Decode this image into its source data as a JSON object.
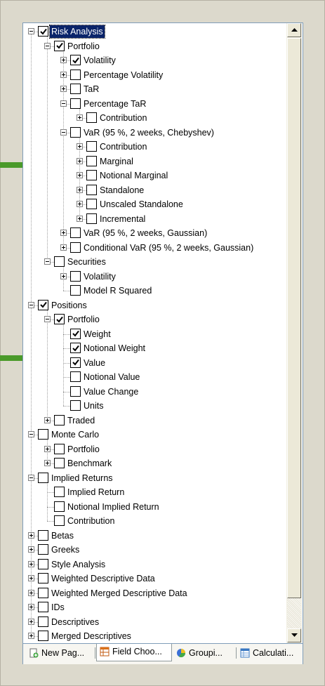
{
  "tree": [
    {
      "label": "Risk Analysis",
      "checked": true,
      "expander": "minus",
      "selected": true
    },
    {
      "label": "Portfolio",
      "checked": true,
      "expander": "minus"
    },
    {
      "label": "Volatility",
      "checked": true,
      "expander": "plus"
    },
    {
      "label": "Percentage Volatility",
      "checked": false,
      "expander": "plus"
    },
    {
      "label": "TaR",
      "checked": false,
      "expander": "plus"
    },
    {
      "label": "Percentage TaR",
      "checked": false,
      "expander": "minus"
    },
    {
      "label": "Contribution",
      "checked": false,
      "expander": "plus"
    },
    {
      "label": "VaR (95 %, 2 weeks, Chebyshev)",
      "checked": false,
      "expander": "minus"
    },
    {
      "label": "Contribution",
      "checked": false,
      "expander": "plus"
    },
    {
      "label": "Marginal",
      "checked": false,
      "expander": "plus"
    },
    {
      "label": "Notional Marginal",
      "checked": false,
      "expander": "plus"
    },
    {
      "label": "Standalone",
      "checked": false,
      "expander": "plus"
    },
    {
      "label": "Unscaled Standalone",
      "checked": false,
      "expander": "plus"
    },
    {
      "label": "Incremental",
      "checked": false,
      "expander": "plus"
    },
    {
      "label": "VaR (95 %, 2 weeks, Gaussian)",
      "checked": false,
      "expander": "plus"
    },
    {
      "label": "Conditional VaR (95 %, 2 weeks, Gaussian)",
      "checked": false,
      "expander": "plus"
    },
    {
      "label": "Securities",
      "checked": false,
      "expander": "minus"
    },
    {
      "label": "Volatility",
      "checked": false,
      "expander": "plus"
    },
    {
      "label": "Model R Squared",
      "checked": false,
      "expander": "none"
    },
    {
      "label": "Positions",
      "checked": true,
      "expander": "minus"
    },
    {
      "label": "Portfolio",
      "checked": true,
      "expander": "minus"
    },
    {
      "label": "Weight",
      "checked": true,
      "expander": "none"
    },
    {
      "label": "Notional Weight",
      "checked": true,
      "expander": "none"
    },
    {
      "label": "Value",
      "checked": true,
      "expander": "none"
    },
    {
      "label": "Notional Value",
      "checked": false,
      "expander": "none"
    },
    {
      "label": "Value Change",
      "checked": false,
      "expander": "none"
    },
    {
      "label": "Units",
      "checked": false,
      "expander": "none"
    },
    {
      "label": "Traded",
      "checked": false,
      "expander": "plus"
    },
    {
      "label": "Monte Carlo",
      "checked": false,
      "expander": "minus"
    },
    {
      "label": "Portfolio",
      "checked": false,
      "expander": "plus"
    },
    {
      "label": "Benchmark",
      "checked": false,
      "expander": "plus"
    },
    {
      "label": "Implied Returns",
      "checked": false,
      "expander": "minus"
    },
    {
      "label": "Implied Return",
      "checked": false,
      "expander": "none"
    },
    {
      "label": "Notional Implied Return",
      "checked": false,
      "expander": "none"
    },
    {
      "label": "Contribution",
      "checked": false,
      "expander": "none"
    },
    {
      "label": "Betas",
      "checked": false,
      "expander": "plus"
    },
    {
      "label": "Greeks",
      "checked": false,
      "expander": "plus"
    },
    {
      "label": "Style Analysis",
      "checked": false,
      "expander": "plus"
    },
    {
      "label": "Weighted Descriptive Data",
      "checked": false,
      "expander": "plus"
    },
    {
      "label": "Weighted Merged Descriptive Data",
      "checked": false,
      "expander": "plus"
    },
    {
      "label": "IDs",
      "checked": false,
      "expander": "plus"
    },
    {
      "label": "Descriptives",
      "checked": false,
      "expander": "plus"
    },
    {
      "label": "Merged Descriptives",
      "checked": false,
      "expander": "plus"
    }
  ],
  "tabs": [
    {
      "label": "New Pag...",
      "icon": "new-page-icon",
      "active": false
    },
    {
      "label": "Field Choo...",
      "icon": "field-chooser-icon",
      "active": true
    },
    {
      "label": "Groupi...",
      "icon": "grouping-icon",
      "active": false
    },
    {
      "label": "Calculati...",
      "icon": "calculation-icon",
      "active": false
    }
  ],
  "colors": {
    "arrow": "#4a9a2a",
    "selection": "#0a246a",
    "accent_border": "#7f9db9"
  }
}
